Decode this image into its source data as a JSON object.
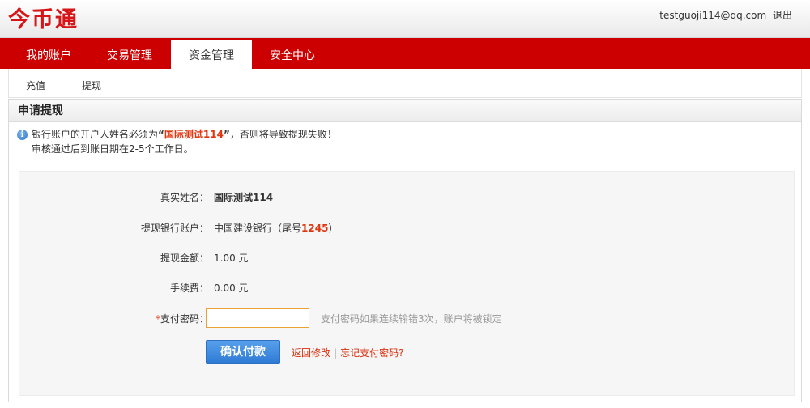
{
  "header": {
    "logo": "今币通",
    "user_email": "testguoji114@qq.com",
    "logout_label": "退出"
  },
  "nav": {
    "items": [
      {
        "label": "我的账户"
      },
      {
        "label": "交易管理"
      },
      {
        "label": "资金管理"
      },
      {
        "label": "安全中心"
      }
    ],
    "active_index": 2
  },
  "subnav": {
    "items": [
      {
        "label": "充值"
      },
      {
        "label": "提现"
      }
    ]
  },
  "panel": {
    "title": "申请提现",
    "notice": {
      "line1_prefix": "银行账户的开户人姓名必须为",
      "quote_open": "“",
      "name": "国际测试114",
      "quote_close": "”",
      "line1_suffix": "，否则将导致提现失败！",
      "line2": "审核通过后到账日期在2-5个工作日。"
    },
    "form": {
      "real_name_label": "真实姓名：",
      "real_name_value": "国际测试114",
      "bank_label": "提现银行账户：",
      "bank_value_prefix": "中国建设银行（尾号",
      "bank_tail": "1245",
      "bank_value_suffix": "）",
      "amount_label": "提现金额：",
      "amount_value": "1.00 元",
      "fee_label": "手续费：",
      "fee_value": "0.00 元",
      "password_required_mark": "*",
      "password_label": "支付密码：",
      "password_value": "",
      "password_hint": "支付密码如果连续输错3次，账户将被锁定"
    },
    "actions": {
      "confirm_label": "确认付款",
      "back_label": "返回修改",
      "separator": "|",
      "forgot_label": "忘记支付密码?"
    }
  },
  "colors": {
    "brand_red": "#cc0000",
    "accent_orange": "#e0360f",
    "button_blue": "#2d7ad4"
  }
}
